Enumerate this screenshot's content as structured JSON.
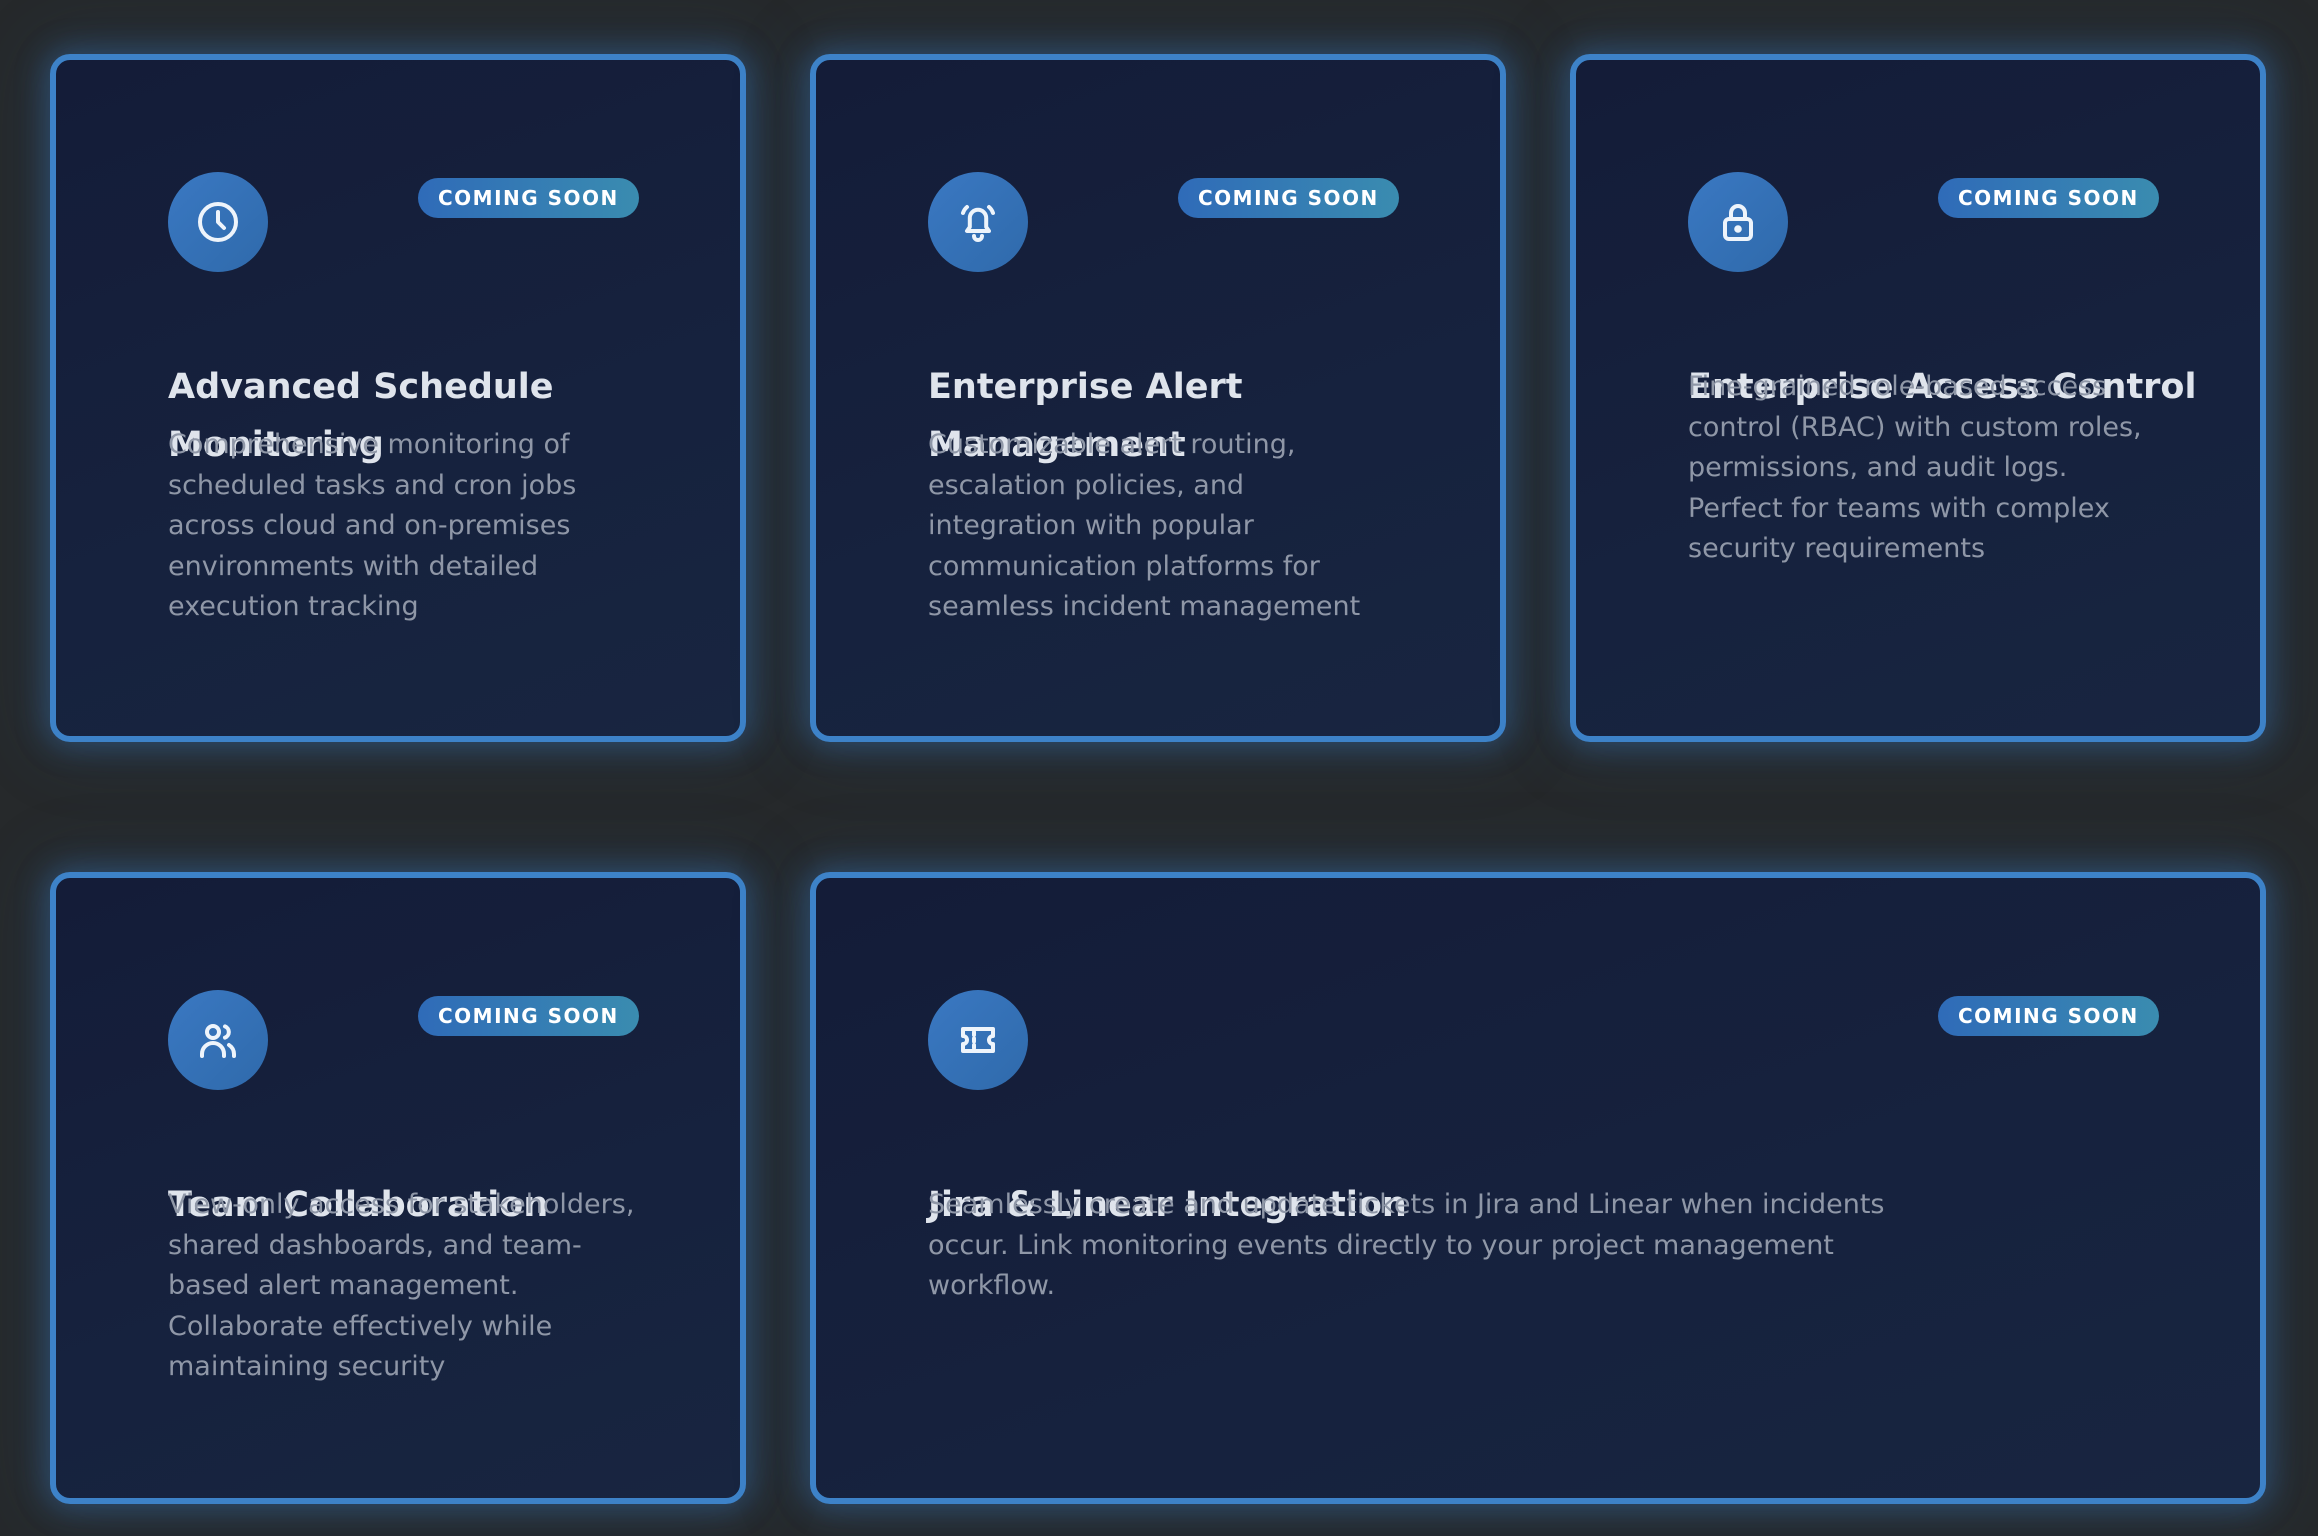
{
  "badge_label": "COMING SOON",
  "colors": {
    "background": "#26292b",
    "card_background": "#141c38",
    "card_border": "#3d82c8",
    "badge": "#2f6bb8",
    "icon_circle": "#3a78c2",
    "title": "#dfe4ec",
    "description": "#8f97a7"
  },
  "features": [
    {
      "icon": "clock-icon",
      "title": "Advanced Schedule Monitoring",
      "description": "Comprehensive monitoring of scheduled tasks and cron jobs across cloud and on-premises environments with detailed execution tracking"
    },
    {
      "icon": "bell-icon",
      "title": "Enterprise Alert Management",
      "description": "Customizable alert routing, escalation policies, and integration with popular communication platforms for seamless incident management"
    },
    {
      "icon": "lock-icon",
      "title": "Enterprise Access Control",
      "description": "Fine-grained role-based access control (RBAC) with custom roles, permissions, and audit logs. Perfect for teams with complex security requirements"
    },
    {
      "icon": "users-icon",
      "title": "Team Collaboration",
      "description": "View-only access for stakeholders, shared dashboards, and team-based alert management. Collaborate effectively while maintaining security"
    },
    {
      "icon": "ticket-icon",
      "title": "Jira & Linear Integration",
      "description": "Seamlessly create and update tickets in Jira and Linear when incidents occur. Link monitoring events directly to your project management workflow."
    }
  ]
}
